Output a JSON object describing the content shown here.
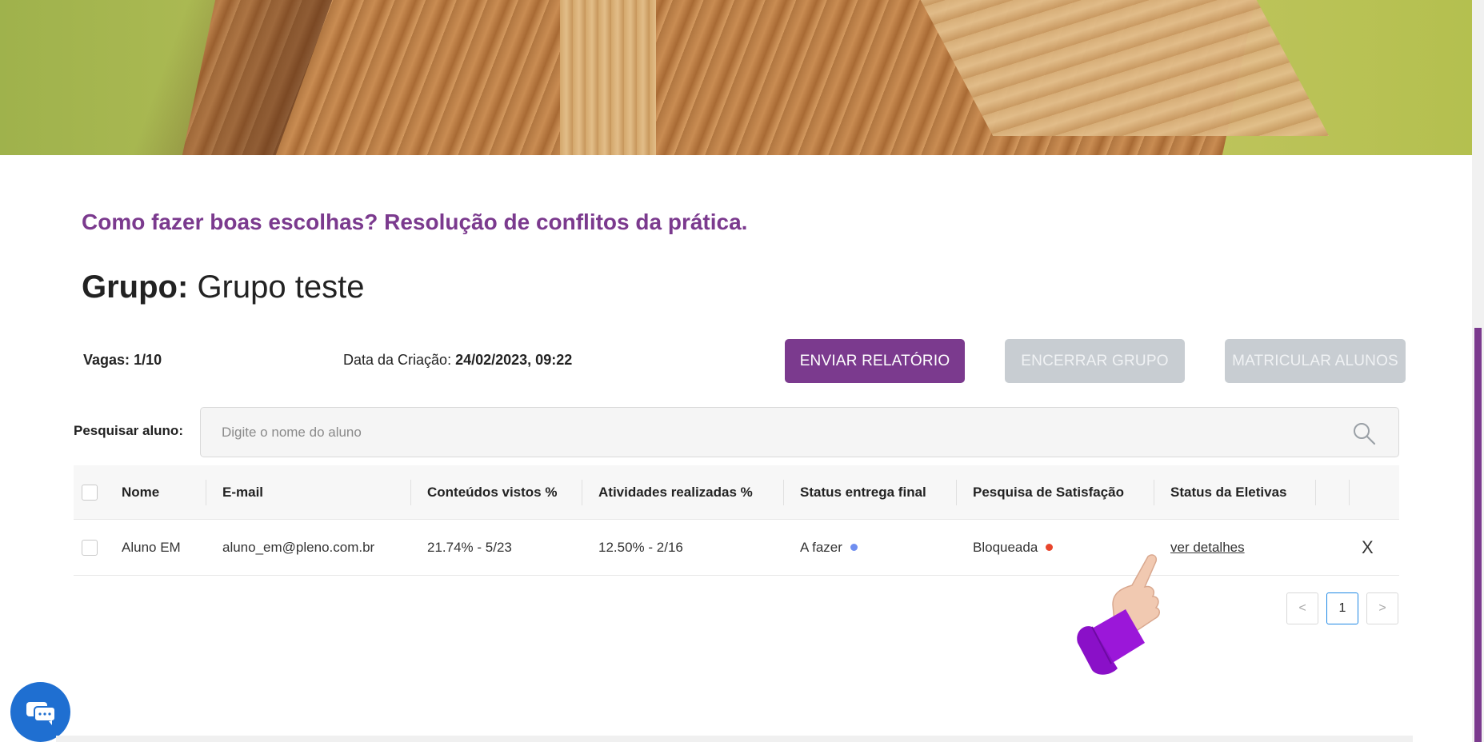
{
  "course": {
    "title": "Como fazer boas escolhas? Resolução de conflitos da prática."
  },
  "group": {
    "label": "Grupo:",
    "name": "Grupo teste"
  },
  "meta": {
    "vagas_label": "Vagas:",
    "vagas_value": "1/10",
    "data_label": "Data da Criação:",
    "data_value": "24/02/2023, 09:22"
  },
  "actions": {
    "send_report": "ENVIAR RELATÓRIO",
    "close_group": "ENCERRAR GRUPO",
    "enroll_students": "MATRICULAR ALUNOS"
  },
  "search": {
    "label": "Pesquisar aluno:",
    "placeholder": "Digite o nome do aluno",
    "value": ""
  },
  "table": {
    "headers": [
      "Nome",
      "E-mail",
      "Conteúdos vistos %",
      "Atividades realizadas %",
      "Status entrega final",
      "Pesquisa de Satisfação",
      "Status da Eletivas"
    ],
    "rows": [
      {
        "nome": "Aluno EM",
        "email": "aluno_em@pleno.com.br",
        "conteudos": "21.74% - 5/23",
        "atividades": "12.50% - 2/16",
        "status_entrega": "A fazer",
        "status_entrega_color": "#6f8ef0",
        "pesquisa": "Bloqueada",
        "pesquisa_color": "#e8452c",
        "eletivas": "ver detalhes",
        "remove": "X"
      }
    ]
  },
  "pagination": {
    "prev": "<",
    "current": "1",
    "next": ">"
  },
  "colors": {
    "accent": "#7b3a8e",
    "disabled": "#c8cdd2",
    "chat": "#1f6fd1",
    "page_border": "#1e88e5"
  },
  "icons": {
    "search": "search-icon",
    "chat": "chat-icon",
    "pointer": "hand-pointer-icon"
  }
}
